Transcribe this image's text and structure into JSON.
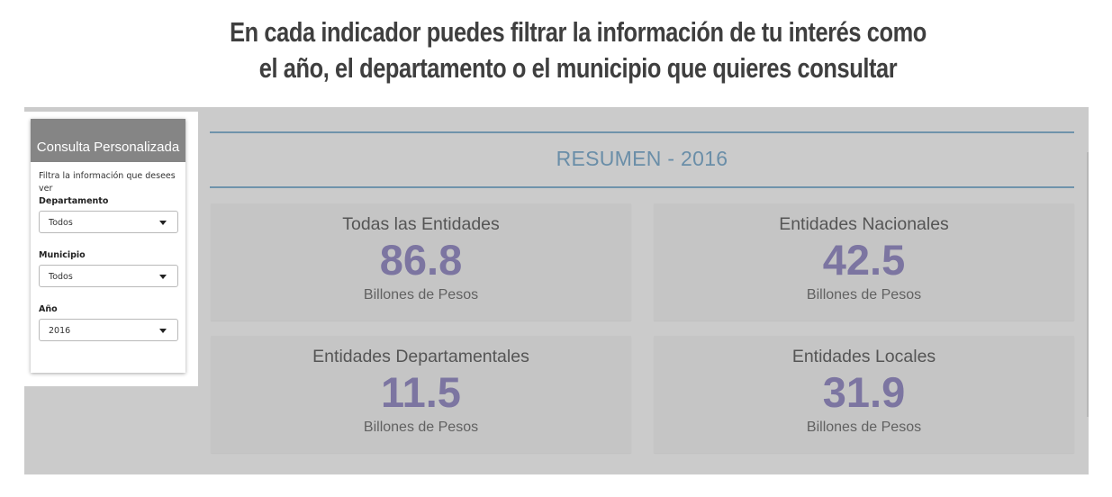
{
  "caption": {
    "line1": "En cada indicador puedes filtrar la información de tu interés como",
    "line2": "el año, el departamento o el municipio que quieres consultar"
  },
  "sidebar": {
    "title": "Consulta Personalizada",
    "help_text": "Filtra la información que desees ver",
    "filters": [
      {
        "label": "Departamento",
        "value": "Todos"
      },
      {
        "label": "Municipio",
        "value": "Todos"
      },
      {
        "label": "Año",
        "value": "2016"
      }
    ]
  },
  "main": {
    "title": "RESUMEN - 2016",
    "cards": [
      {
        "title": "Todas las Entidades",
        "value": "86.8",
        "unit": "Billones de Pesos"
      },
      {
        "title": "Entidades Nacionales",
        "value": "42.5",
        "unit": "Billones de Pesos"
      },
      {
        "title": "Entidades Departamentales",
        "value": "11.5",
        "unit": "Billones de Pesos"
      },
      {
        "title": "Entidades Locales",
        "value": "31.9",
        "unit": "Billones de Pesos"
      }
    ]
  },
  "colors": {
    "accent_blue": "#6a8ea8",
    "value_purple": "#7c75a1",
    "panel_header": "#858585",
    "background": "#cbcbcb"
  }
}
